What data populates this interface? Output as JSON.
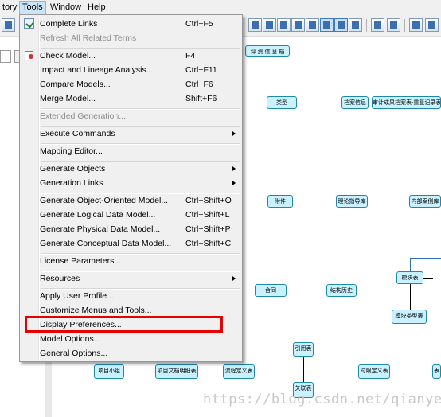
{
  "menubar": {
    "items": [
      {
        "label": "tory"
      },
      {
        "label": "Tools"
      },
      {
        "label": "Window"
      },
      {
        "label": "Help"
      }
    ]
  },
  "tools_menu": {
    "items": [
      {
        "label": "Complete Links",
        "shortcut": "Ctrl+F5",
        "icon": "complete-links-icon",
        "disabled": false
      },
      {
        "label": "Refresh All Related Terms",
        "shortcut": "",
        "disabled": true
      },
      {
        "label": "Check Model...",
        "shortcut": "F4",
        "icon": "check-model-icon",
        "disabled": false
      },
      {
        "label": "Impact and Lineage Analysis...",
        "shortcut": "Ctrl+F11",
        "disabled": false
      },
      {
        "label": "Compare Models...",
        "shortcut": "Ctrl+F6",
        "disabled": false
      },
      {
        "label": "Merge Model...",
        "shortcut": "Shift+F6",
        "disabled": false
      },
      {
        "label": "Extended Generation...",
        "shortcut": "",
        "disabled": true
      },
      {
        "label": "Execute Commands",
        "shortcut": "",
        "submenu": true,
        "disabled": false
      },
      {
        "label": "Mapping Editor...",
        "shortcut": "",
        "disabled": false
      },
      {
        "label": "Generate Objects",
        "shortcut": "",
        "submenu": true,
        "disabled": false
      },
      {
        "label": "Generation Links",
        "shortcut": "",
        "submenu": true,
        "disabled": false
      },
      {
        "label": "Generate Object-Oriented Model...",
        "shortcut": "Ctrl+Shift+O",
        "disabled": false
      },
      {
        "label": "Generate Logical Data Model...",
        "shortcut": "Ctrl+Shift+L",
        "disabled": false
      },
      {
        "label": "Generate Physical Data Model...",
        "shortcut": "Ctrl+Shift+P",
        "disabled": false
      },
      {
        "label": "Generate Conceptual Data Model...",
        "shortcut": "Ctrl+Shift+C",
        "disabled": false
      },
      {
        "label": "License Parameters...",
        "shortcut": "",
        "disabled": false
      },
      {
        "label": "Resources",
        "shortcut": "",
        "submenu": true,
        "disabled": false
      },
      {
        "label": "Apply User Profile...",
        "shortcut": "",
        "disabled": false
      },
      {
        "label": "Customize Menus and Tools...",
        "shortcut": "",
        "disabled": false
      },
      {
        "label": "Display Preferences...",
        "shortcut": "",
        "disabled": false,
        "highlighted": true
      },
      {
        "label": "Model Options...",
        "shortcut": "",
        "disabled": false
      },
      {
        "label": "General Options...",
        "shortcut": "",
        "disabled": false
      }
    ]
  },
  "diagram": {
    "entities": [
      {
        "id": "e0",
        "title": "评 资 信 息 档"
      },
      {
        "id": "e1",
        "title": "类型"
      },
      {
        "id": "e2",
        "title": "档案信息"
      },
      {
        "id": "e3",
        "title": "审计成果档案表-重复记录表"
      },
      {
        "id": "e4",
        "title": "附件"
      },
      {
        "id": "e5",
        "title": "理论指导库"
      },
      {
        "id": "e6",
        "title": "内部案例库"
      },
      {
        "id": "e7",
        "title": "模块表"
      },
      {
        "id": "e8",
        "title": "合同"
      },
      {
        "id": "e9",
        "title": "结构历史"
      },
      {
        "id": "e10",
        "title": "模块类型表"
      },
      {
        "id": "e11",
        "title": "引用表"
      },
      {
        "id": "e12",
        "title": "项目小组"
      },
      {
        "id": "e13",
        "title": "项目文档明细表"
      },
      {
        "id": "e14",
        "title": "流程定义表"
      },
      {
        "id": "e15",
        "title": "时限定义表"
      },
      {
        "id": "e16",
        "title": "关联表"
      },
      {
        "id": "e17",
        "title": "表"
      }
    ]
  },
  "watermark": "https://blog.csdn.net/qianyel",
  "colors": {
    "entity_fill": "#c9f1ff",
    "entity_border": "#1e88a8",
    "highlight": "#e60000",
    "menu_bg": "#f0f0f0"
  }
}
